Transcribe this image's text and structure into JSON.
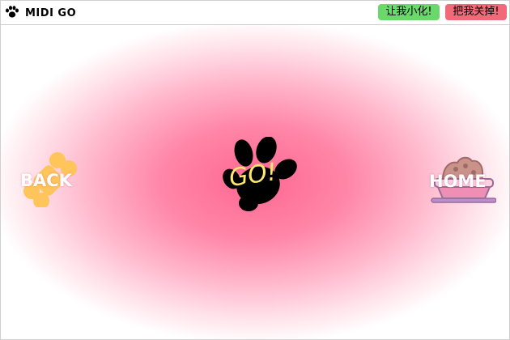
{
  "window": {
    "title": "MIDI GO",
    "app_icon": "paw-icon"
  },
  "titlebar_buttons": {
    "minimize_label": "让我小化!",
    "close_label": "把我关掉!",
    "minimize_color": "#6ad86a",
    "close_color": "#f16a7a"
  },
  "stage": {
    "center_color": "#ff6790",
    "edge_color": "#ffffff"
  },
  "back": {
    "label": "BACK",
    "icon": "bone-icon",
    "icon_color": "#ffc45a"
  },
  "go": {
    "label": "GO!",
    "icon": "paw-print-icon",
    "label_color": "#ffe96a"
  },
  "home": {
    "label": "HOME",
    "icon": "food-bowl-icon",
    "icon_color": "#f08fb5"
  }
}
